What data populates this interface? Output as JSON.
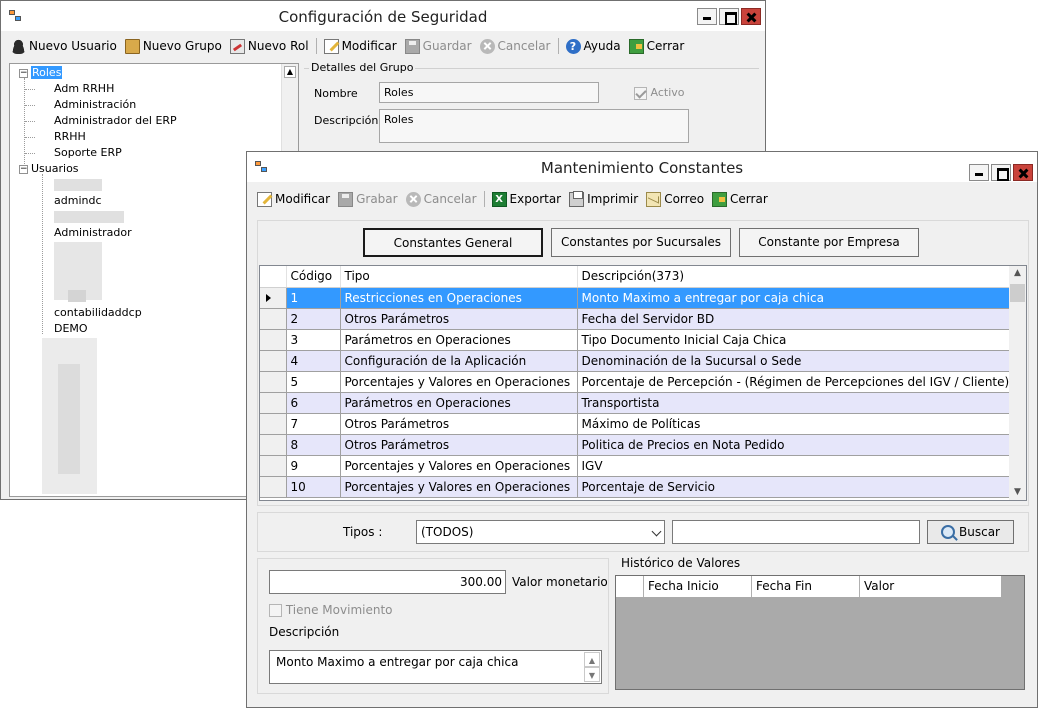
{
  "security_window": {
    "title": "Configuración de Seguridad",
    "toolbar": {
      "new_user": "Nuevo Usuario",
      "new_group": "Nuevo Grupo",
      "new_role": "Nuevo Rol",
      "modify": "Modificar",
      "save": "Guardar",
      "cancel": "Cancelar",
      "help": "Ayuda",
      "close": "Cerrar"
    },
    "tree": {
      "roles_label": "Roles",
      "roles": [
        "Adm RRHH",
        "Administración",
        "Administrador del ERP",
        "RRHH",
        "Soporte ERP"
      ],
      "users_label": "Usuarios",
      "users_visible": [
        "admindc",
        "Administrador",
        "contabilidaddcp",
        "DEMO"
      ]
    },
    "group_details": {
      "legend": "Detalles del Grupo",
      "name_label": "Nombre",
      "name_value": "Roles",
      "active_label": "Activo",
      "active_checked": true,
      "description_label": "Descripción",
      "description_value": "Roles"
    }
  },
  "constants_window": {
    "title": "Mantenimiento Constantes",
    "toolbar": {
      "modify": "Modificar",
      "save": "Grabar",
      "cancel": "Cancelar",
      "export": "Exportar",
      "print": "Imprimir",
      "mail": "Correo",
      "close": "Cerrar"
    },
    "tabs": [
      "Constantes General",
      "Constantes por Sucursales",
      "Constante por Empresa"
    ],
    "grid": {
      "headers": [
        "Código",
        "Tipo",
        "Descripción(373)"
      ],
      "rows": [
        [
          "1",
          "Restricciones en Operaciones",
          "Monto Maximo a entregar por caja chica"
        ],
        [
          "2",
          "Otros Parámetros",
          "Fecha del Servidor BD"
        ],
        [
          "3",
          "Parámetros en Operaciones",
          "Tipo Documento Inicial Caja Chica"
        ],
        [
          "4",
          "Configuración de la Aplicación",
          "Denominación de la Sucursal o Sede"
        ],
        [
          "5",
          "Porcentajes y Valores en Operaciones",
          "Porcentaje de Percepción - (Régimen de Percepciones del IGV / Cliente)"
        ],
        [
          "6",
          "Parámetros en Operaciones",
          "Transportista"
        ],
        [
          "7",
          "Otros Parámetros",
          "Máximo de Políticas"
        ],
        [
          "8",
          "Otros Parámetros",
          "Politica de Precios en Nota Pedido"
        ],
        [
          "9",
          "Porcentajes y Valores en Operaciones",
          "IGV"
        ],
        [
          "10",
          "Porcentajes y Valores en Operaciones",
          "Porcentaje de Servicio"
        ]
      ]
    },
    "filter": {
      "types_label": "Tipos :",
      "types_value": "(TODOS)",
      "search_value": "",
      "search_button": "Buscar"
    },
    "detail": {
      "amount_value": "300.00",
      "amount_label": "Valor monetario",
      "has_movement_label": "Tiene Movimiento",
      "description_label": "Descripción",
      "description_value": "Monto Maximo a entregar por caja chica"
    },
    "history": {
      "legend": "Histórico de Valores",
      "headers": [
        "Fecha Inicio",
        "Fecha Fin",
        "Valor"
      ]
    }
  }
}
